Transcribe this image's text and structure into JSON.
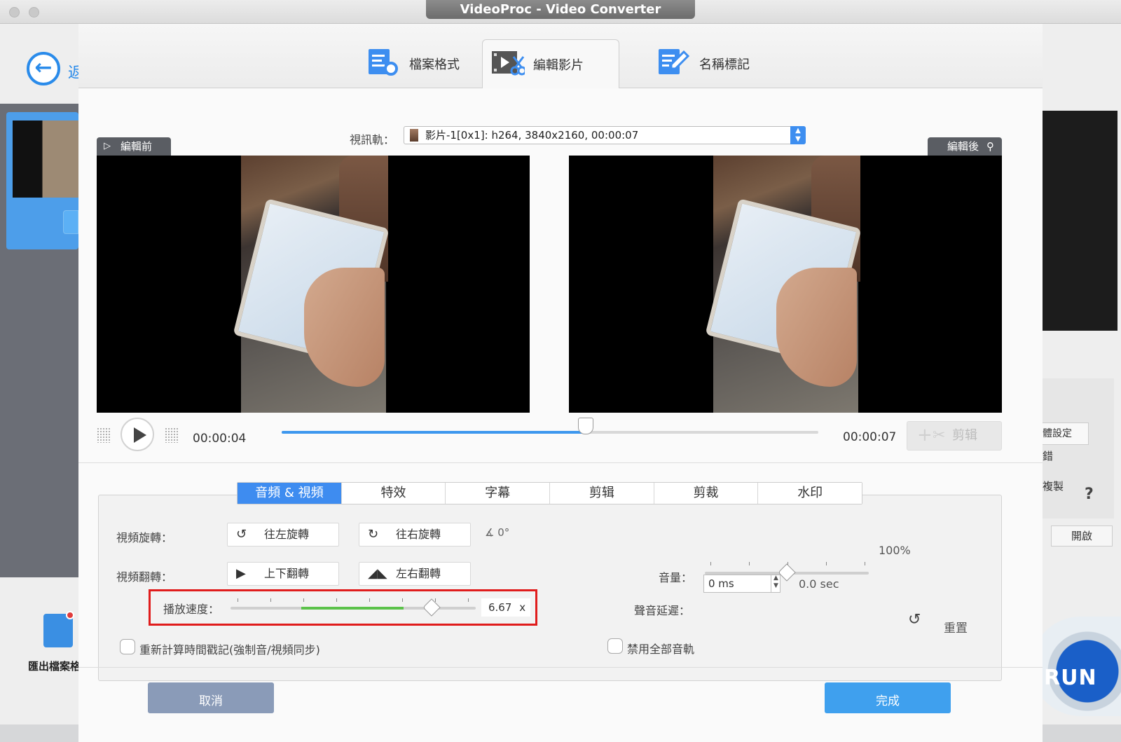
{
  "window": {
    "title": "VideoProc - Video Converter"
  },
  "background": {
    "back_partial": "返",
    "export_label": "匯出檔案格式",
    "right_setting": "體設定",
    "right_error": "錯",
    "right_copy": "複製",
    "right_help": "?",
    "right_open": "開啟",
    "run_label": "RUN"
  },
  "tabs": [
    {
      "label": "檔案格式",
      "icon": "file-settings-icon"
    },
    {
      "label": "編輯影片",
      "icon": "film-scissors-icon",
      "active": true
    },
    {
      "label": "名稱標記",
      "icon": "edit-document-icon"
    }
  ],
  "track": {
    "label": "視訊軌：",
    "value": "影片-1[0x1]: h264, 3840x2160, 00:00:07"
  },
  "preview": {
    "before_label": "編輯前",
    "after_label": "編輯後"
  },
  "playback": {
    "current_time": "00:00:04",
    "end_time": "00:00:07",
    "progress": 0.567,
    "cut_label": "剪辑"
  },
  "subtabs": [
    {
      "label": "音頻 & 視頻",
      "active": true
    },
    {
      "label": "特效"
    },
    {
      "label": "字幕"
    },
    {
      "label": "剪辑"
    },
    {
      "label": "剪裁"
    },
    {
      "label": "水印"
    }
  ],
  "settings": {
    "rotate_label": "視頻旋轉：",
    "rotate_left": "往左旋轉",
    "rotate_right": "往右旋轉",
    "angle": "0°",
    "flip_label": "視頻翻轉：",
    "flip_vertical": "上下翻轉",
    "flip_horizontal": "左右翻轉",
    "speed_label": "播放速度：",
    "speed_value": "6.67",
    "speed_unit": "x",
    "speed_level": 0.82,
    "volume_label": "音量：",
    "volume_value": "100%",
    "volume_level": 0.5,
    "delay_label": "聲音延遲：",
    "delay_value": "0 ms",
    "delay_sec": "0.0 sec",
    "recalc_label": "重新計算時間戳記(強制音/視頻同步)",
    "disable_audio_label": "禁用全部音軌",
    "reset_label": "重置"
  },
  "buttons": {
    "cancel": "取消",
    "done": "完成"
  },
  "colors": {
    "accent": "#3e8cf0",
    "highlight_box": "#e01c1c",
    "speed_green": "#5bc24a"
  }
}
